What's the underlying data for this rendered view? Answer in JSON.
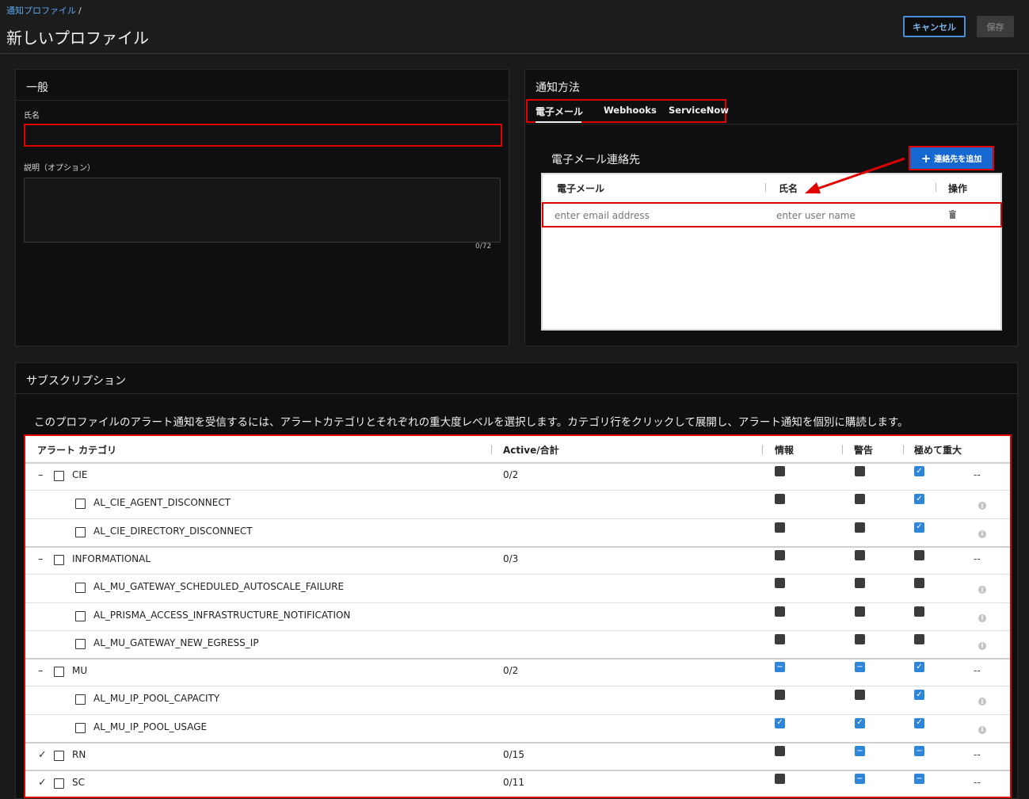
{
  "header": {
    "breadcrumb": "通知プロファイル",
    "breadcrumb_sep": "/",
    "title": "新しいプロファイル",
    "cancel_label": "キャンセル",
    "save_label": "保存"
  },
  "general": {
    "title": "一般",
    "name_label": "氏名",
    "name_value": "",
    "description_label": "説明（オプション）",
    "description_value": "",
    "counter": "0/72"
  },
  "notify": {
    "title": "通知方法",
    "tabs": [
      {
        "label": "電子メール",
        "active": true
      },
      {
        "label": "Webhooks",
        "active": false
      },
      {
        "label": "ServiceNow",
        "active": false
      }
    ],
    "contacts_title": "電子メール連絡先",
    "add_contact_label": "連絡先を追加",
    "columns": [
      "電子メール",
      "氏名",
      "操作"
    ],
    "email_placeholder": "enter email address",
    "name_placeholder": "enter user name"
  },
  "subscriptions": {
    "title": "サブスクリプション",
    "description": "このプロファイルのアラート通知を受信するには、アラートカテゴリとそれぞれの重大度レベルを選択します。カテゴリ行をクリックして展開し、アラート通知を個別に購読します。",
    "columns": [
      "アラート カテゴリ",
      "Active/合計",
      "情報",
      "警告",
      "極めて重大"
    ],
    "rows": [
      {
        "label": "CIE",
        "count": "0/2",
        "expander": "–",
        "child": false,
        "sev": [
          "dark",
          "dark",
          "checked"
        ],
        "tail": "--"
      },
      {
        "label": "AL_CIE_AGENT_DISCONNECT",
        "count": "",
        "child": true,
        "sev": [
          "dark",
          "dark",
          "checked"
        ],
        "tail": "i"
      },
      {
        "label": "AL_CIE_DIRECTORY_DISCONNECT",
        "count": "",
        "child": true,
        "sev": [
          "dark",
          "dark",
          "checked"
        ],
        "tail": "i"
      },
      {
        "label": "INFORMATIONAL",
        "count": "0/3",
        "expander": "–",
        "child": false,
        "sev": [
          "dark",
          "dark",
          "dark"
        ],
        "tail": "--"
      },
      {
        "label": "AL_MU_GATEWAY_SCHEDULED_AUTOSCALE_FAILURE",
        "count": "",
        "child": true,
        "sev": [
          "dark",
          "dark",
          "dark"
        ],
        "tail": "i"
      },
      {
        "label": "AL_PRISMA_ACCESS_INFRASTRUCTURE_NOTIFICATION",
        "count": "",
        "child": true,
        "sev": [
          "dark",
          "dark",
          "dark"
        ],
        "tail": "i"
      },
      {
        "label": "AL_MU_GATEWAY_NEW_EGRESS_IP",
        "count": "",
        "child": true,
        "sev": [
          "dark",
          "dark",
          "dark"
        ],
        "tail": "i"
      },
      {
        "label": "MU",
        "count": "0/2",
        "expander": "–",
        "child": false,
        "sev": [
          "partial",
          "partial",
          "checked"
        ],
        "tail": "--"
      },
      {
        "label": "AL_MU_IP_POOL_CAPACITY",
        "count": "",
        "child": true,
        "sev": [
          "dark",
          "dark",
          "checked"
        ],
        "tail": "i"
      },
      {
        "label": "AL_MU_IP_POOL_USAGE",
        "count": "",
        "child": true,
        "sev": [
          "checked",
          "checked",
          "checked"
        ],
        "tail": "i"
      },
      {
        "label": "RN",
        "count": "0/15",
        "expander": "✓",
        "child": false,
        "sev": [
          "dark",
          "partial",
          "partial"
        ],
        "tail": "--"
      },
      {
        "label": "SC",
        "count": "0/11",
        "expander": "✓",
        "child": false,
        "sev": [
          "dark",
          "partial",
          "partial"
        ],
        "tail": "--"
      }
    ]
  },
  "colors": {
    "accent": "#1667d0",
    "highlight": "#e00000",
    "checked": "#2f86d8",
    "panel": "#0f0f0f"
  }
}
